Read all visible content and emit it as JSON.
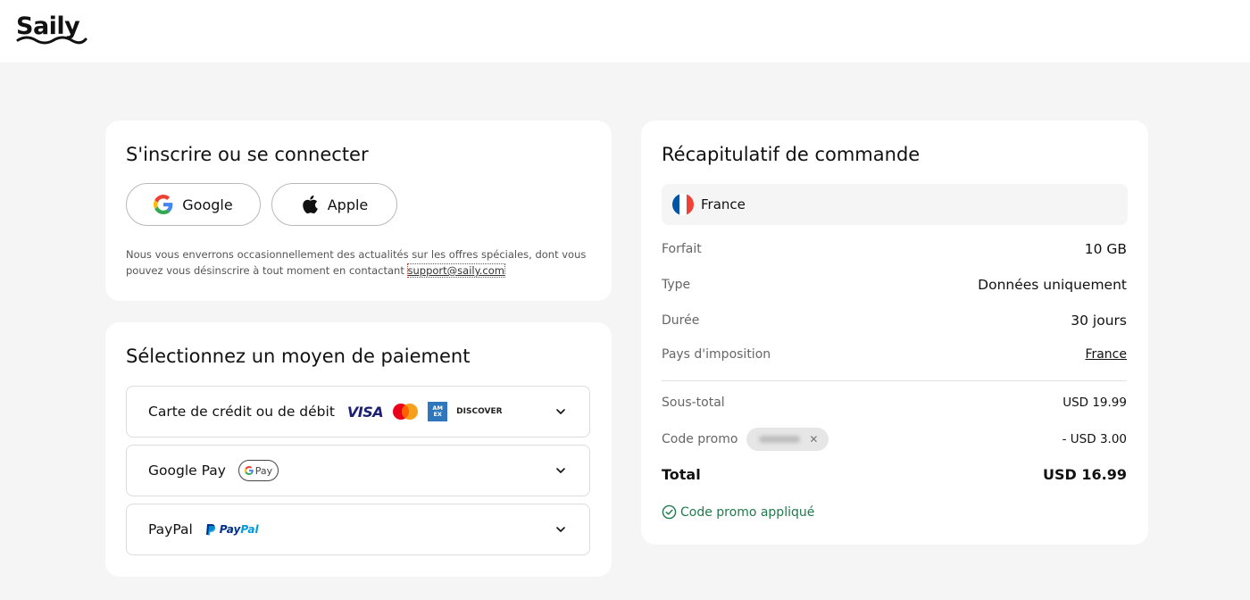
{
  "brand": {
    "logo_text": "Saily"
  },
  "login": {
    "title": "S'inscrire ou se connecter",
    "google_label": "Google",
    "apple_label": "Apple",
    "notice_text": "Nous vous enverrons occasionnellement des actualités sur les offres spéciales, dont vous pouvez vous désinscrire à tout moment en contactant ",
    "support_email": "support@saily.com"
  },
  "payment": {
    "title": "Sélectionnez un moyen de paiement",
    "options": [
      {
        "label": "Carte de crédit ou de débit",
        "logos": [
          "VISA",
          "mastercard-icon",
          "AMEX",
          "DISCOVER"
        ]
      },
      {
        "label": "Google Pay",
        "logos": [
          "G Pay"
        ]
      },
      {
        "label": "PayPal",
        "logos": [
          "PayPal"
        ]
      }
    ],
    "card_logos": {
      "visa": "VISA",
      "amex_line1": "AM",
      "amex_line2": "EX",
      "discover": "DISCOVER"
    },
    "gpay_text": "Pay",
    "paypal_logo_pay": "Pay",
    "paypal_logo_pal": "Pal"
  },
  "summary": {
    "title": "Récapitulatif de commande",
    "country": "France",
    "rows": {
      "plan_label": "Forfait",
      "plan_value": "10 GB",
      "type_label": "Type",
      "type_value": "Données uniquement",
      "duration_label": "Durée",
      "duration_value": "30 jours",
      "tax_country_label": "Pays d'imposition",
      "tax_country_value": "France",
      "subtotal_label": "Sous-total",
      "subtotal_value": "USD 19.99",
      "promo_label": "Code promo",
      "promo_value": "- USD 3.00",
      "total_label": "Total",
      "total_value": "USD 16.99"
    },
    "promo_applied": "Code promo appliqué"
  },
  "colors": {
    "background": "#f5f5f5",
    "card": "#ffffff",
    "success": "#1f7a4c",
    "visa_blue": "#1a1f71",
    "paypal_dark": "#003087",
    "paypal_light": "#009cde",
    "flag_blue": "#0055a4",
    "flag_red": "#ef4135"
  }
}
